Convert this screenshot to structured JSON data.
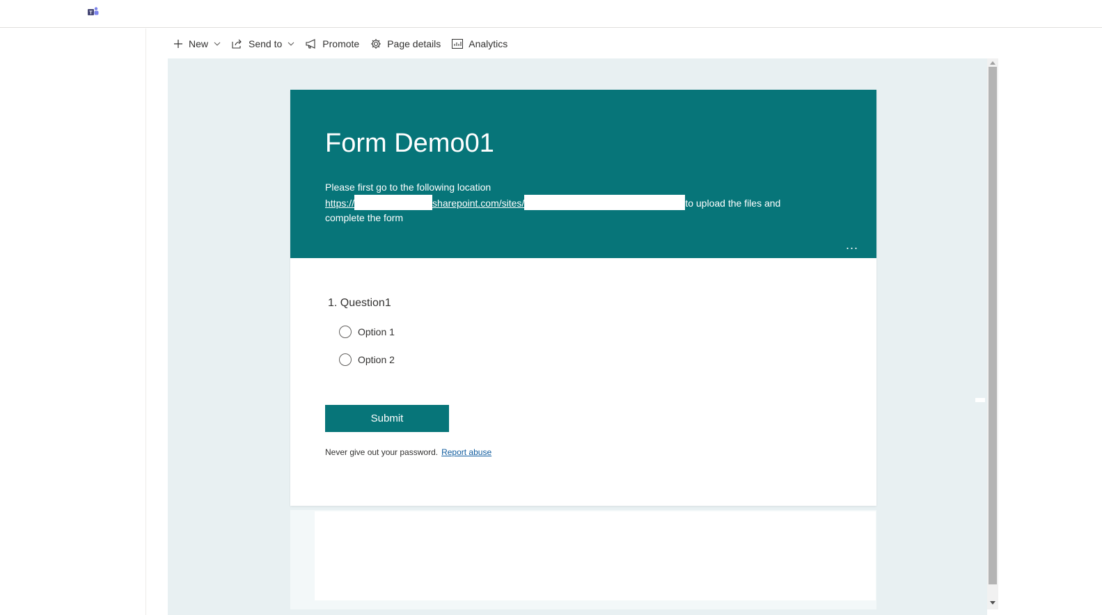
{
  "app": {
    "icon": "teams-icon"
  },
  "commandbar": {
    "new_label": "New",
    "sendto_label": "Send to",
    "promote_label": "Promote",
    "pagedetails_label": "Page details",
    "analytics_label": "Analytics"
  },
  "form": {
    "title": "Form Demo01",
    "desc_line1": "Please first go to the following location",
    "link_part1": "https://",
    "link_part2": "sharepoint.com/sites/",
    "desc_after_link": "to upload the files and",
    "desc_line3": "complete the form",
    "more_label": "...",
    "question": "1. Question1",
    "options": [
      "Option 1",
      "Option 2"
    ],
    "submit_label": "Submit",
    "footer_text": "Never give out your password.",
    "report_label": "Report abuse"
  },
  "colors": {
    "brand": "#077579",
    "canvas": "#e8f0f2"
  }
}
